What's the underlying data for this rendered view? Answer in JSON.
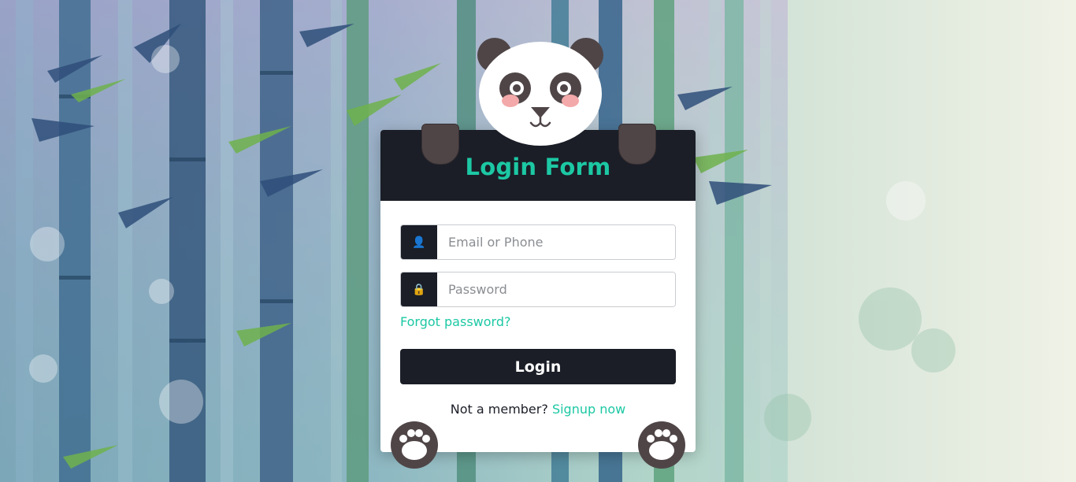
{
  "form": {
    "title": "Login Form",
    "email_placeholder": "Email or Phone",
    "password_placeholder": "Password",
    "forgot_label": "Forgot password?",
    "login_label": "Login",
    "signup_prompt": "Not a member?",
    "signup_link": "Signup now"
  },
  "icons": {
    "email_icon": "user-icon",
    "password_icon": "lock-icon",
    "email_glyph": "👤",
    "password_glyph": "🔒"
  },
  "colors": {
    "accent": "#1cc8a4",
    "dark": "#1b1e27",
    "panda_dark": "#4f4547",
    "cheek": "#f3a9a9"
  }
}
